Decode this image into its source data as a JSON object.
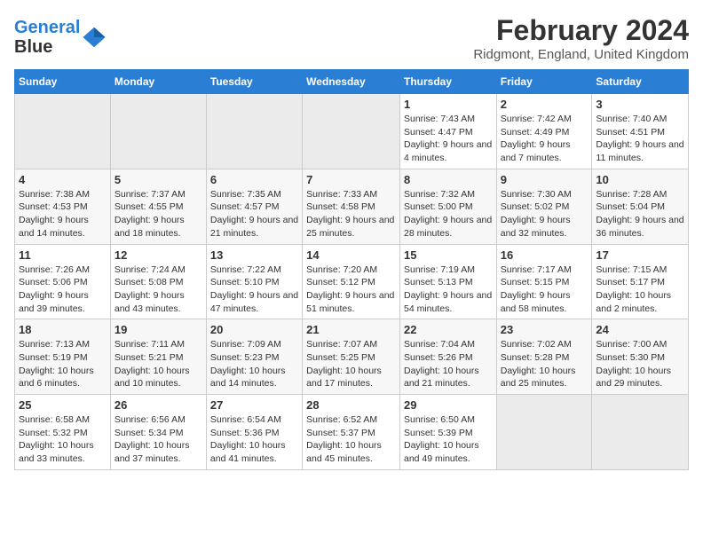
{
  "logo": {
    "line1": "General",
    "line2": "Blue"
  },
  "title": "February 2024",
  "subtitle": "Ridgmont, England, United Kingdom",
  "header": {
    "accent_color": "#2a7fd4"
  },
  "weekdays": [
    "Sunday",
    "Monday",
    "Tuesday",
    "Wednesday",
    "Thursday",
    "Friday",
    "Saturday"
  ],
  "weeks": [
    [
      {
        "day": "",
        "empty": true
      },
      {
        "day": "",
        "empty": true
      },
      {
        "day": "",
        "empty": true
      },
      {
        "day": "",
        "empty": true
      },
      {
        "day": "1",
        "sunrise": "7:43 AM",
        "sunset": "4:47 PM",
        "daylight": "9 hours and 4 minutes."
      },
      {
        "day": "2",
        "sunrise": "7:42 AM",
        "sunset": "4:49 PM",
        "daylight": "9 hours and 7 minutes."
      },
      {
        "day": "3",
        "sunrise": "7:40 AM",
        "sunset": "4:51 PM",
        "daylight": "9 hours and 11 minutes."
      }
    ],
    [
      {
        "day": "4",
        "sunrise": "7:38 AM",
        "sunset": "4:53 PM",
        "daylight": "9 hours and 14 minutes."
      },
      {
        "day": "5",
        "sunrise": "7:37 AM",
        "sunset": "4:55 PM",
        "daylight": "9 hours and 18 minutes."
      },
      {
        "day": "6",
        "sunrise": "7:35 AM",
        "sunset": "4:57 PM",
        "daylight": "9 hours and 21 minutes."
      },
      {
        "day": "7",
        "sunrise": "7:33 AM",
        "sunset": "4:58 PM",
        "daylight": "9 hours and 25 minutes."
      },
      {
        "day": "8",
        "sunrise": "7:32 AM",
        "sunset": "5:00 PM",
        "daylight": "9 hours and 28 minutes."
      },
      {
        "day": "9",
        "sunrise": "7:30 AM",
        "sunset": "5:02 PM",
        "daylight": "9 hours and 32 minutes."
      },
      {
        "day": "10",
        "sunrise": "7:28 AM",
        "sunset": "5:04 PM",
        "daylight": "9 hours and 36 minutes."
      }
    ],
    [
      {
        "day": "11",
        "sunrise": "7:26 AM",
        "sunset": "5:06 PM",
        "daylight": "9 hours and 39 minutes."
      },
      {
        "day": "12",
        "sunrise": "7:24 AM",
        "sunset": "5:08 PM",
        "daylight": "9 hours and 43 minutes."
      },
      {
        "day": "13",
        "sunrise": "7:22 AM",
        "sunset": "5:10 PM",
        "daylight": "9 hours and 47 minutes."
      },
      {
        "day": "14",
        "sunrise": "7:20 AM",
        "sunset": "5:12 PM",
        "daylight": "9 hours and 51 minutes."
      },
      {
        "day": "15",
        "sunrise": "7:19 AM",
        "sunset": "5:13 PM",
        "daylight": "9 hours and 54 minutes."
      },
      {
        "day": "16",
        "sunrise": "7:17 AM",
        "sunset": "5:15 PM",
        "daylight": "9 hours and 58 minutes."
      },
      {
        "day": "17",
        "sunrise": "7:15 AM",
        "sunset": "5:17 PM",
        "daylight": "10 hours and 2 minutes."
      }
    ],
    [
      {
        "day": "18",
        "sunrise": "7:13 AM",
        "sunset": "5:19 PM",
        "daylight": "10 hours and 6 minutes."
      },
      {
        "day": "19",
        "sunrise": "7:11 AM",
        "sunset": "5:21 PM",
        "daylight": "10 hours and 10 minutes."
      },
      {
        "day": "20",
        "sunrise": "7:09 AM",
        "sunset": "5:23 PM",
        "daylight": "10 hours and 14 minutes."
      },
      {
        "day": "21",
        "sunrise": "7:07 AM",
        "sunset": "5:25 PM",
        "daylight": "10 hours and 17 minutes."
      },
      {
        "day": "22",
        "sunrise": "7:04 AM",
        "sunset": "5:26 PM",
        "daylight": "10 hours and 21 minutes."
      },
      {
        "day": "23",
        "sunrise": "7:02 AM",
        "sunset": "5:28 PM",
        "daylight": "10 hours and 25 minutes."
      },
      {
        "day": "24",
        "sunrise": "7:00 AM",
        "sunset": "5:30 PM",
        "daylight": "10 hours and 29 minutes."
      }
    ],
    [
      {
        "day": "25",
        "sunrise": "6:58 AM",
        "sunset": "5:32 PM",
        "daylight": "10 hours and 33 minutes."
      },
      {
        "day": "26",
        "sunrise": "6:56 AM",
        "sunset": "5:34 PM",
        "daylight": "10 hours and 37 minutes."
      },
      {
        "day": "27",
        "sunrise": "6:54 AM",
        "sunset": "5:36 PM",
        "daylight": "10 hours and 41 minutes."
      },
      {
        "day": "28",
        "sunrise": "6:52 AM",
        "sunset": "5:37 PM",
        "daylight": "10 hours and 45 minutes."
      },
      {
        "day": "29",
        "sunrise": "6:50 AM",
        "sunset": "5:39 PM",
        "daylight": "10 hours and 49 minutes."
      },
      {
        "day": "",
        "empty": true
      },
      {
        "day": "",
        "empty": true
      }
    ]
  ],
  "labels": {
    "sunrise": "Sunrise:",
    "sunset": "Sunset:",
    "daylight": "Daylight:"
  }
}
